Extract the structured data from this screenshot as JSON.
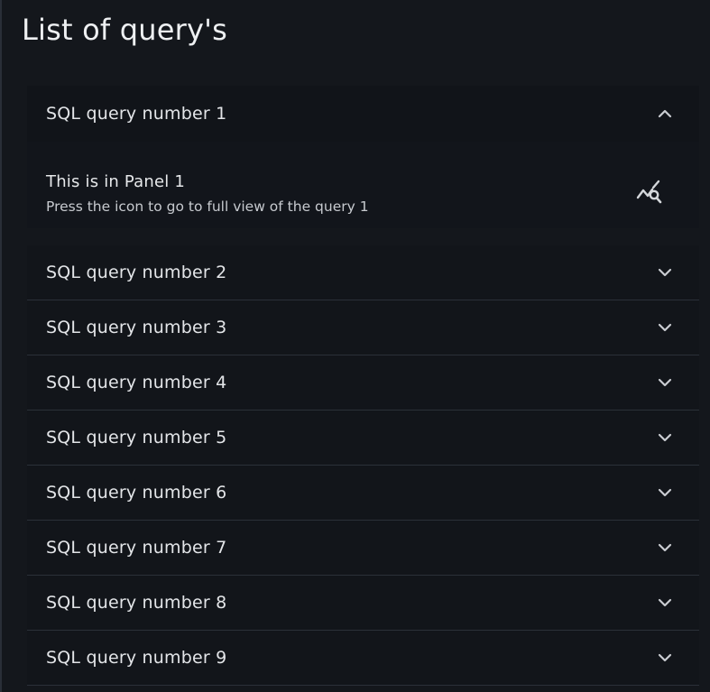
{
  "page": {
    "title": "List of query's"
  },
  "accordion": {
    "panels": [
      {
        "label": "SQL query number 1",
        "expanded": true,
        "body_title": "This is in Panel 1",
        "body_text": "Press the icon to go to full view of the query 1",
        "action_icon": "query-stats-icon"
      },
      {
        "label": "SQL query number 2",
        "expanded": false
      },
      {
        "label": "SQL query number 3",
        "expanded": false
      },
      {
        "label": "SQL query number 4",
        "expanded": false
      },
      {
        "label": "SQL query number 5",
        "expanded": false
      },
      {
        "label": "SQL query number 6",
        "expanded": false
      },
      {
        "label": "SQL query number 7",
        "expanded": false
      },
      {
        "label": "SQL query number 8",
        "expanded": false
      },
      {
        "label": "SQL query number 9",
        "expanded": false
      }
    ]
  },
  "colors": {
    "background": "#14171c",
    "panel": "#12151a",
    "divider": "#2b3038",
    "text": "#e3e5e8",
    "icon": "#c9ccd1"
  }
}
